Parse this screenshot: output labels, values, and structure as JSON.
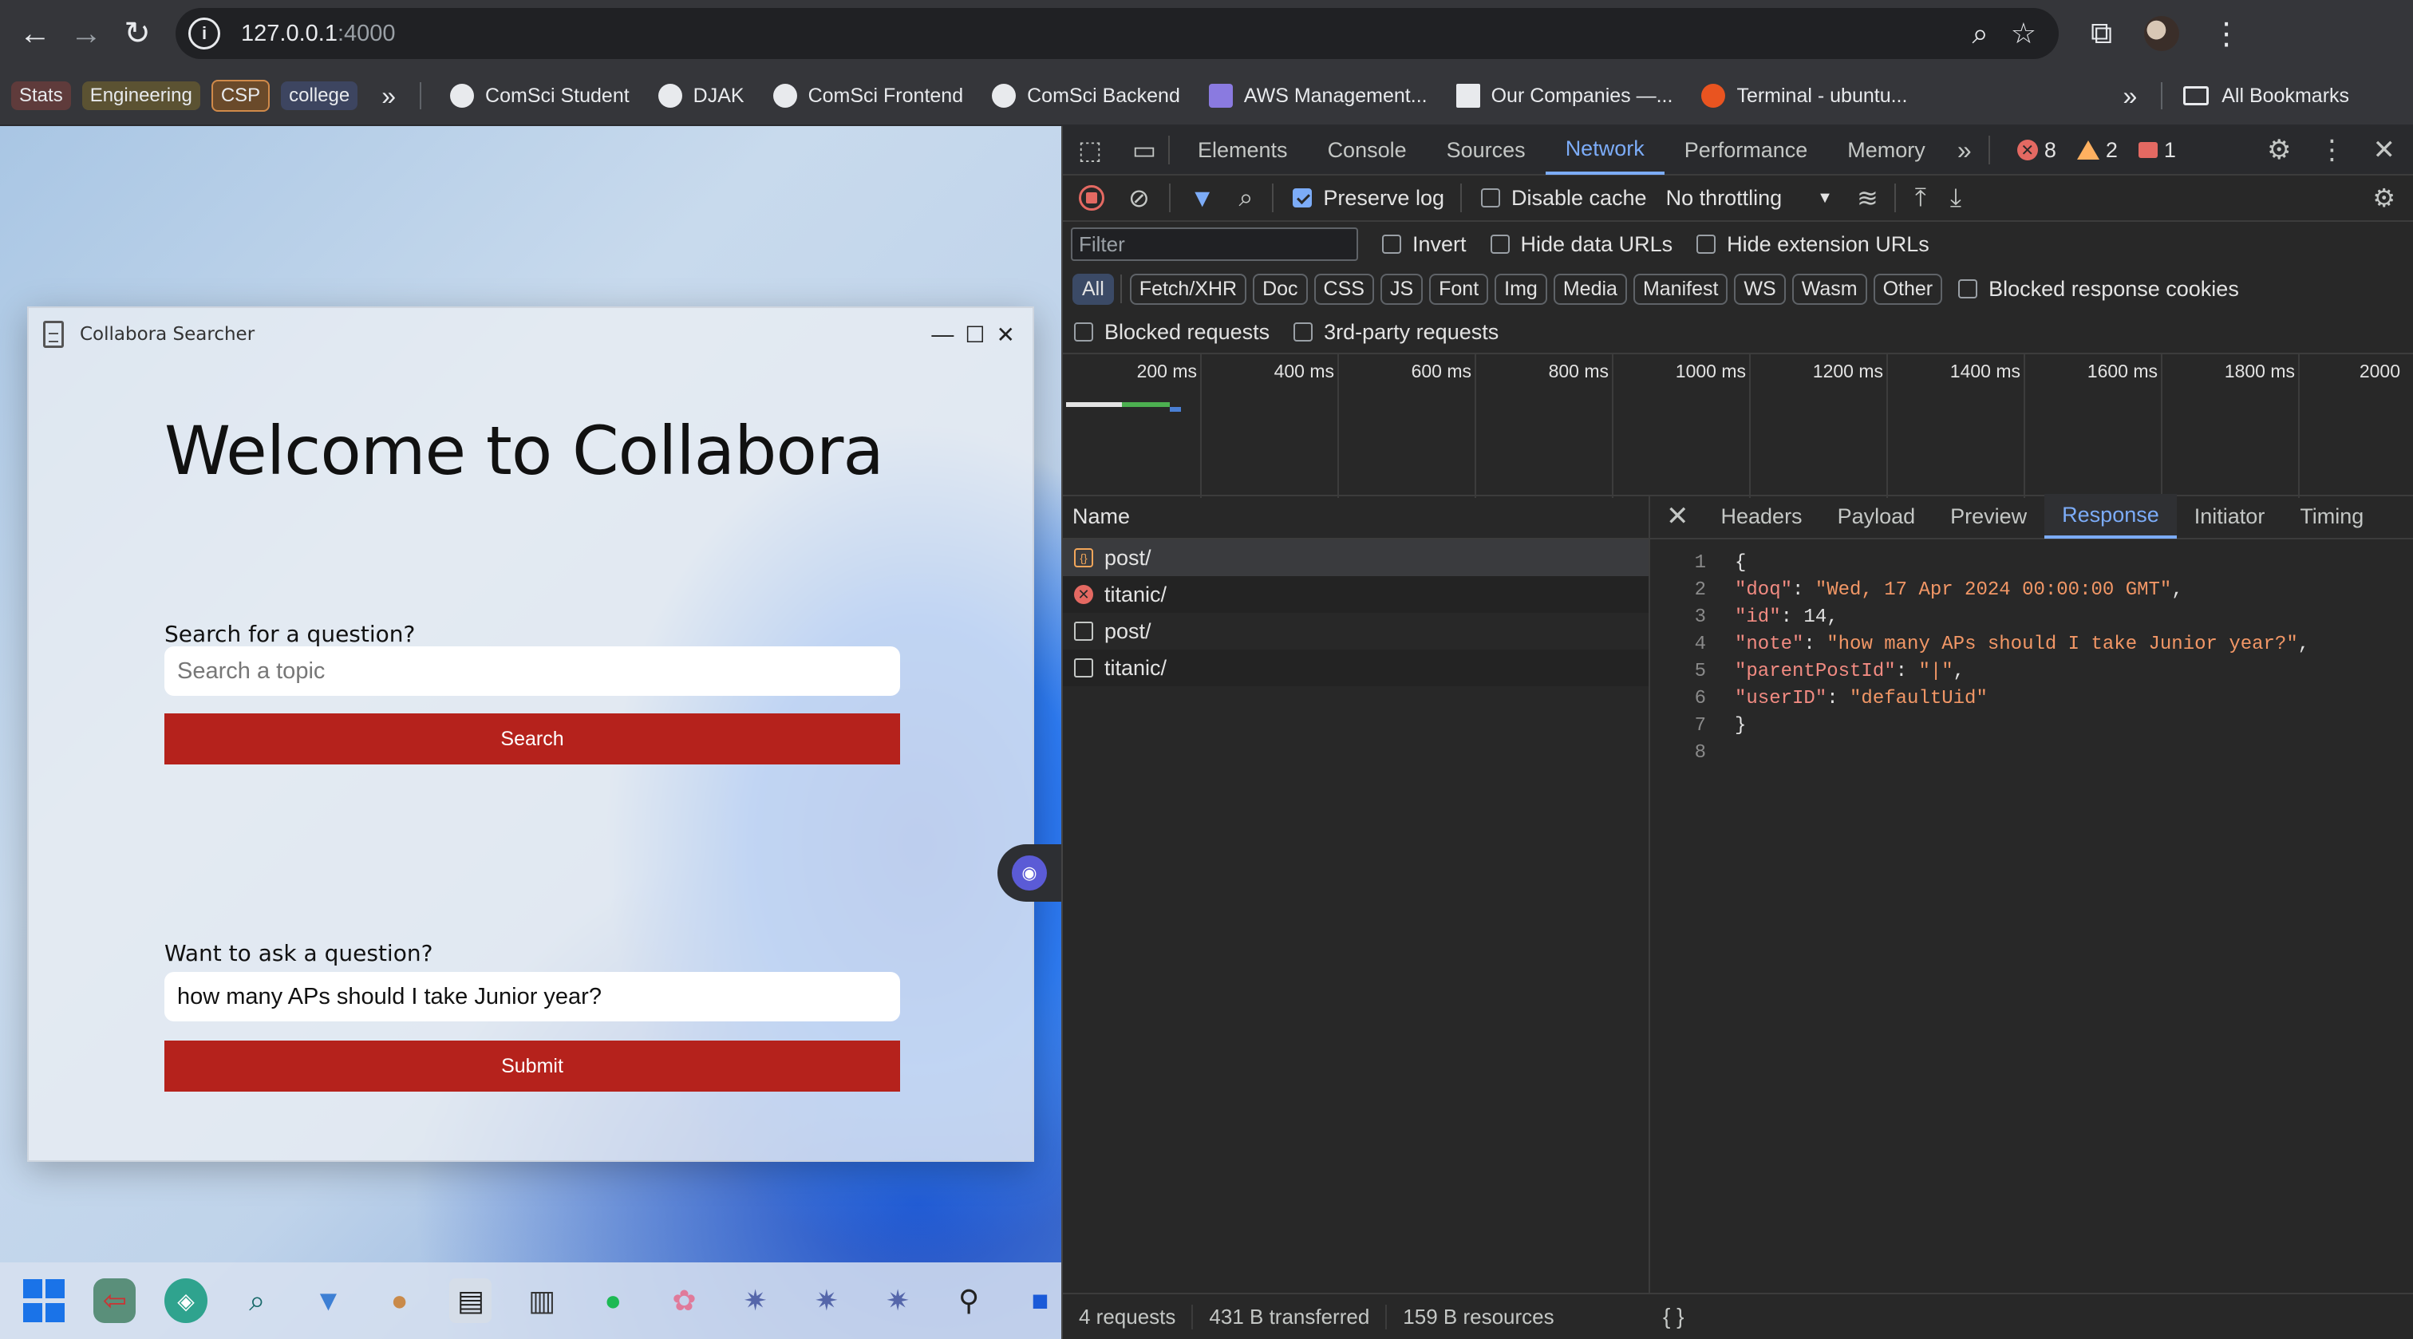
{
  "browser": {
    "url_host": "127.0.0.1",
    "url_port": ":4000",
    "bookmark_groups": [
      {
        "label": "Stats",
        "color": "#5f3b3b"
      },
      {
        "label": "Engineering",
        "color": "#5b5232"
      },
      {
        "label": "CSP",
        "color": "#6a4a2a"
      },
      {
        "label": "college",
        "color": "#3d4560"
      }
    ],
    "bookmarks": [
      "ComSci Student",
      "DJAK",
      "ComSci Frontend",
      "ComSci Backend",
      "AWS Management...",
      "Our Companies —...",
      "Terminal - ubuntu..."
    ],
    "all_bookmarks": "All Bookmarks"
  },
  "app": {
    "title": "Collabora Searcher",
    "welcome": "Welcome to Collabora",
    "search_label": "Search for a question?",
    "search_placeholder": "Search a topic",
    "search_button": "Search",
    "ask_label": "Want to ask a question?",
    "ask_value": "how many APs should I take Junior year?",
    "submit_button": "Submit"
  },
  "devtools": {
    "tabs": [
      "Elements",
      "Console",
      "Sources",
      "Network",
      "Performance",
      "Memory"
    ],
    "active_tab": "Network",
    "errors": "8",
    "warnings": "2",
    "issues": "1",
    "preserve_log": "Preserve log",
    "disable_cache": "Disable cache",
    "throttling": "No throttling",
    "filter_placeholder": "Filter",
    "invert": "Invert",
    "hide_data_urls": "Hide data URLs",
    "hide_extension_urls": "Hide extension URLs",
    "types": [
      "All",
      "Fetch/XHR",
      "Doc",
      "CSS",
      "JS",
      "Font",
      "Img",
      "Media",
      "Manifest",
      "WS",
      "Wasm",
      "Other"
    ],
    "blocked_response_cookies": "Blocked response cookies",
    "blocked_requests": "Blocked requests",
    "third_party": "3rd-party requests",
    "timeline_ticks": [
      "200 ms",
      "400 ms",
      "600 ms",
      "800 ms",
      "1000 ms",
      "1200 ms",
      "1400 ms",
      "1600 ms",
      "1800 ms",
      "2000"
    ],
    "name_header": "Name",
    "requests": [
      {
        "name": "post/",
        "kind": "xhr"
      },
      {
        "name": "titanic/",
        "kind": "error"
      },
      {
        "name": "post/",
        "kind": "doc"
      },
      {
        "name": "titanic/",
        "kind": "doc"
      }
    ],
    "detail_tabs": [
      "Headers",
      "Payload",
      "Preview",
      "Response",
      "Initiator",
      "Timing"
    ],
    "active_detail_tab": "Response",
    "response_lines": [
      {
        "num": "1",
        "key": "",
        "value": "",
        "text": "{"
      },
      {
        "num": "2",
        "key": "\"doq\"",
        "value": "\"Wed, 17 Apr 2024 00:00:00 GMT\"",
        "suffix": ","
      },
      {
        "num": "3",
        "key": "\"id\"",
        "value": "14",
        "suffix": ","
      },
      {
        "num": "4",
        "key": "\"note\"",
        "value": "\"how many APs should I take Junior year?\"",
        "suffix": ","
      },
      {
        "num": "5",
        "key": "\"parentPostId\"",
        "value": "\"|\"",
        "suffix": ","
      },
      {
        "num": "6",
        "key": "\"userID\"",
        "value": "\"defaultUid\"",
        "suffix": ""
      },
      {
        "num": "7",
        "key": "",
        "value": "",
        "text": "}"
      },
      {
        "num": "8",
        "key": "",
        "value": "",
        "text": ""
      }
    ],
    "footer": {
      "requests": "4 requests",
      "transferred": "431 B transferred",
      "resources": "159 B resources",
      "braces": "{ }"
    }
  }
}
